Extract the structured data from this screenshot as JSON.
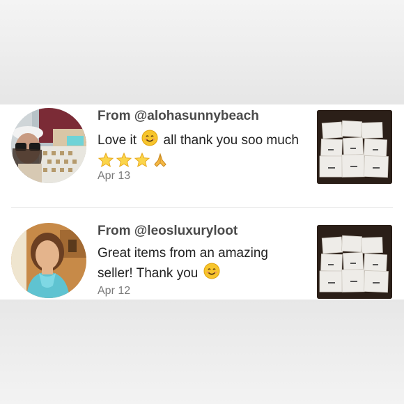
{
  "reviews": [
    {
      "from": "From @alohasunnybeach",
      "comment_part1": "Love it",
      "comment_part2": "all thank you soo much",
      "emojis": [
        "smiling-face-emoji",
        "glowing-star-emoji",
        "glowing-star-emoji",
        "glowing-star-emoji",
        "folded-hands-emoji"
      ],
      "date": "Apr 13"
    },
    {
      "from": "From @leosluxuryloot",
      "comment_part1": "Great items from an amazing seller! Thank you",
      "emojis": [
        "smiling-face-emoji"
      ],
      "date": "Apr 12"
    }
  ],
  "colors": {
    "text_primary": "#222222",
    "text_username": "#4a4a4a",
    "text_date": "#7a7a7a",
    "background": "#ffffff",
    "blur_band": "#ececec"
  }
}
